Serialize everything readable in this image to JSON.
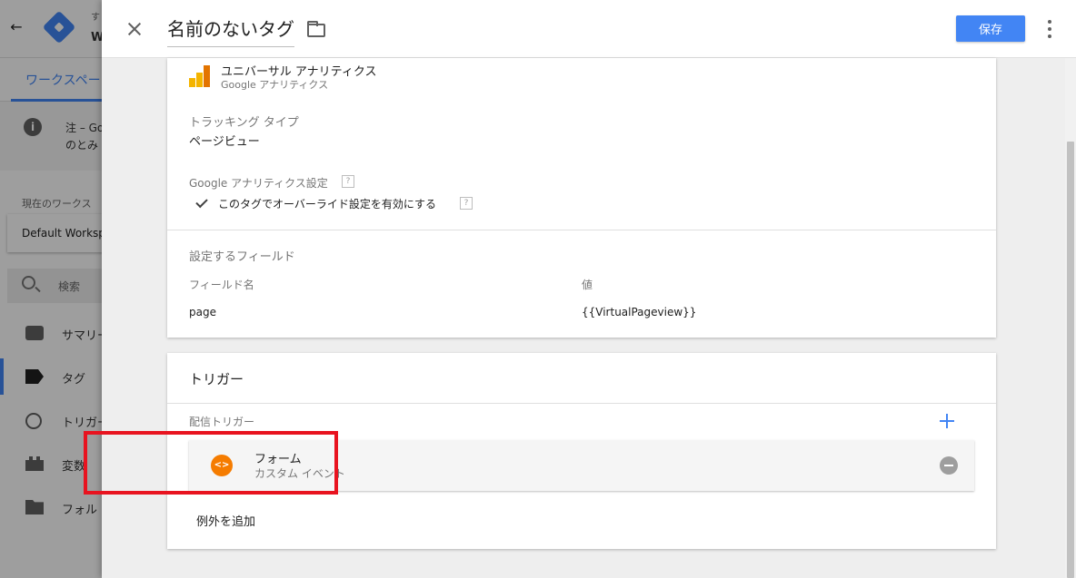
{
  "background_app": {
    "account_label": "す",
    "container_label": "W",
    "tab_workspace": "ワークスペー",
    "note_line1": "注 – Go",
    "note_line2": "のとみ",
    "current_workspace_label": "現在のワークス",
    "workspace_value": "Default Worksp",
    "search_label": "検索",
    "nav_items": [
      {
        "label": "サマリー",
        "icon": "summary-icon"
      },
      {
        "label": "タグ",
        "icon": "tag-icon"
      },
      {
        "label": "トリガー",
        "icon": "trigger-icon"
      },
      {
        "label": "変数",
        "icon": "variable-icon"
      },
      {
        "label": "フォル",
        "icon": "folder-icon"
      }
    ],
    "accent_color": "#4285f4"
  },
  "panel": {
    "tag_name": "名前のないタグ",
    "save_label": "保存",
    "save_color": "#4285f4"
  },
  "config": {
    "tag_type_name": "ユニバーサル アナリティクス",
    "tag_type_sub": "Google アナリティクス",
    "tracking_type_label": "トラッキング タイプ",
    "tracking_type_value": "ページビュー",
    "ga_settings_label": "Google アナリティクス設定",
    "override_label": "このタグでオーバーライド設定を有効にする",
    "help_glyph": "?",
    "fields_to_set_label": "設定するフィールド",
    "field_name_header": "フィールド名",
    "value_header": "値",
    "fields": [
      {
        "name": "page",
        "value": "{{VirtualPageview}}"
      }
    ]
  },
  "triggering": {
    "title": "トリガー",
    "firing_triggers_label": "配信トリガー",
    "trigger": {
      "name": "フォーム",
      "type": "カスタム イベント",
      "icon_glyph": "<>",
      "icon_color": "#f57c00"
    },
    "add_exception_label": "例外を追加"
  },
  "highlight_color": "#e8131f"
}
